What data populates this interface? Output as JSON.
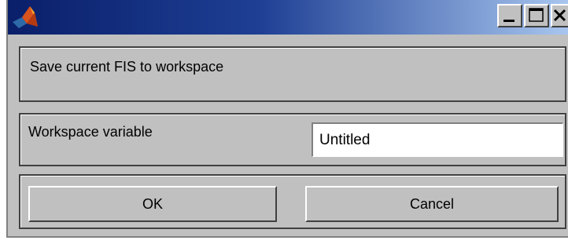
{
  "window": {
    "icon": "matlab-logo-icon",
    "controls": {
      "minimize": "minimize-icon",
      "maximize": "maximize-icon",
      "close": "close-icon"
    }
  },
  "dialog": {
    "message": "Save current FIS to workspace",
    "variable_label": "Workspace variable",
    "variable_value": "Untitled",
    "ok_label": "OK",
    "cancel_label": "Cancel"
  },
  "colors": {
    "face": "#c0c0c0",
    "title_start": "#0a1f6a",
    "title_end": "#a8c6ef"
  }
}
